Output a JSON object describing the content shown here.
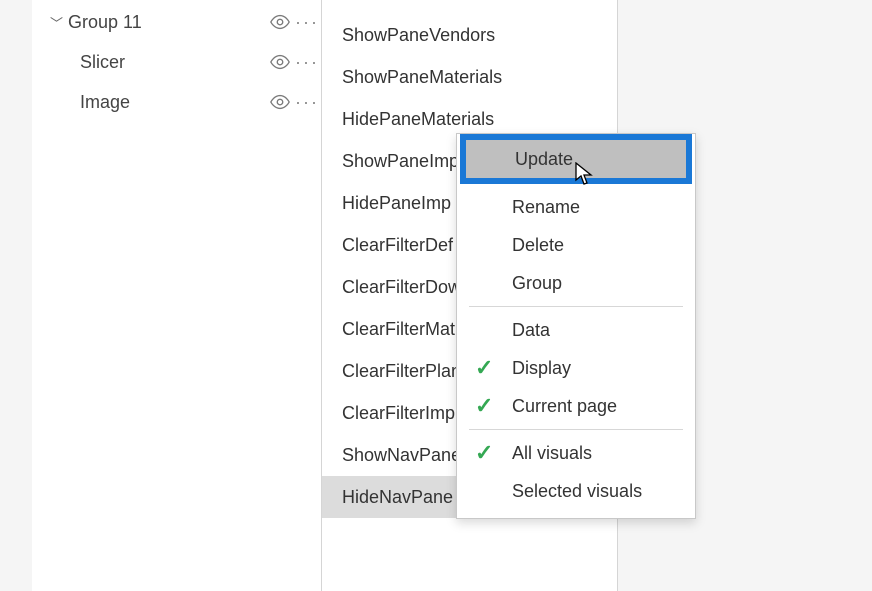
{
  "selection": {
    "items": [
      {
        "label": "Group 11",
        "expandable": true
      },
      {
        "label": "Slicer",
        "expandable": false
      },
      {
        "label": "Image",
        "expandable": false
      }
    ]
  },
  "bookmarks": {
    "items": [
      {
        "label": "ShowPaneVendors",
        "selected": false
      },
      {
        "label": "ShowPaneMaterials",
        "selected": false
      },
      {
        "label": "HidePaneMaterials",
        "selected": false
      },
      {
        "label": "ShowPaneImp",
        "selected": false
      },
      {
        "label": "HidePaneImp",
        "selected": false
      },
      {
        "label": "ClearFilterDef",
        "selected": false
      },
      {
        "label": "ClearFilterDow",
        "selected": false
      },
      {
        "label": "ClearFilterMat",
        "selected": false
      },
      {
        "label": "ClearFilterPlan",
        "selected": false
      },
      {
        "label": "ClearFilterImp",
        "selected": false
      },
      {
        "label": "ShowNavPane",
        "selected": false
      },
      {
        "label": "HideNavPane",
        "selected": true
      }
    ]
  },
  "context_menu": {
    "update": "Update",
    "rename": "Rename",
    "delete": "Delete",
    "group": "Group",
    "data": "Data",
    "display": "Display",
    "current_page": "Current page",
    "all_visuals": "All visuals",
    "selected_visuals": "Selected visuals",
    "checked": {
      "display": true,
      "current_page": true,
      "all_visuals": true
    }
  }
}
